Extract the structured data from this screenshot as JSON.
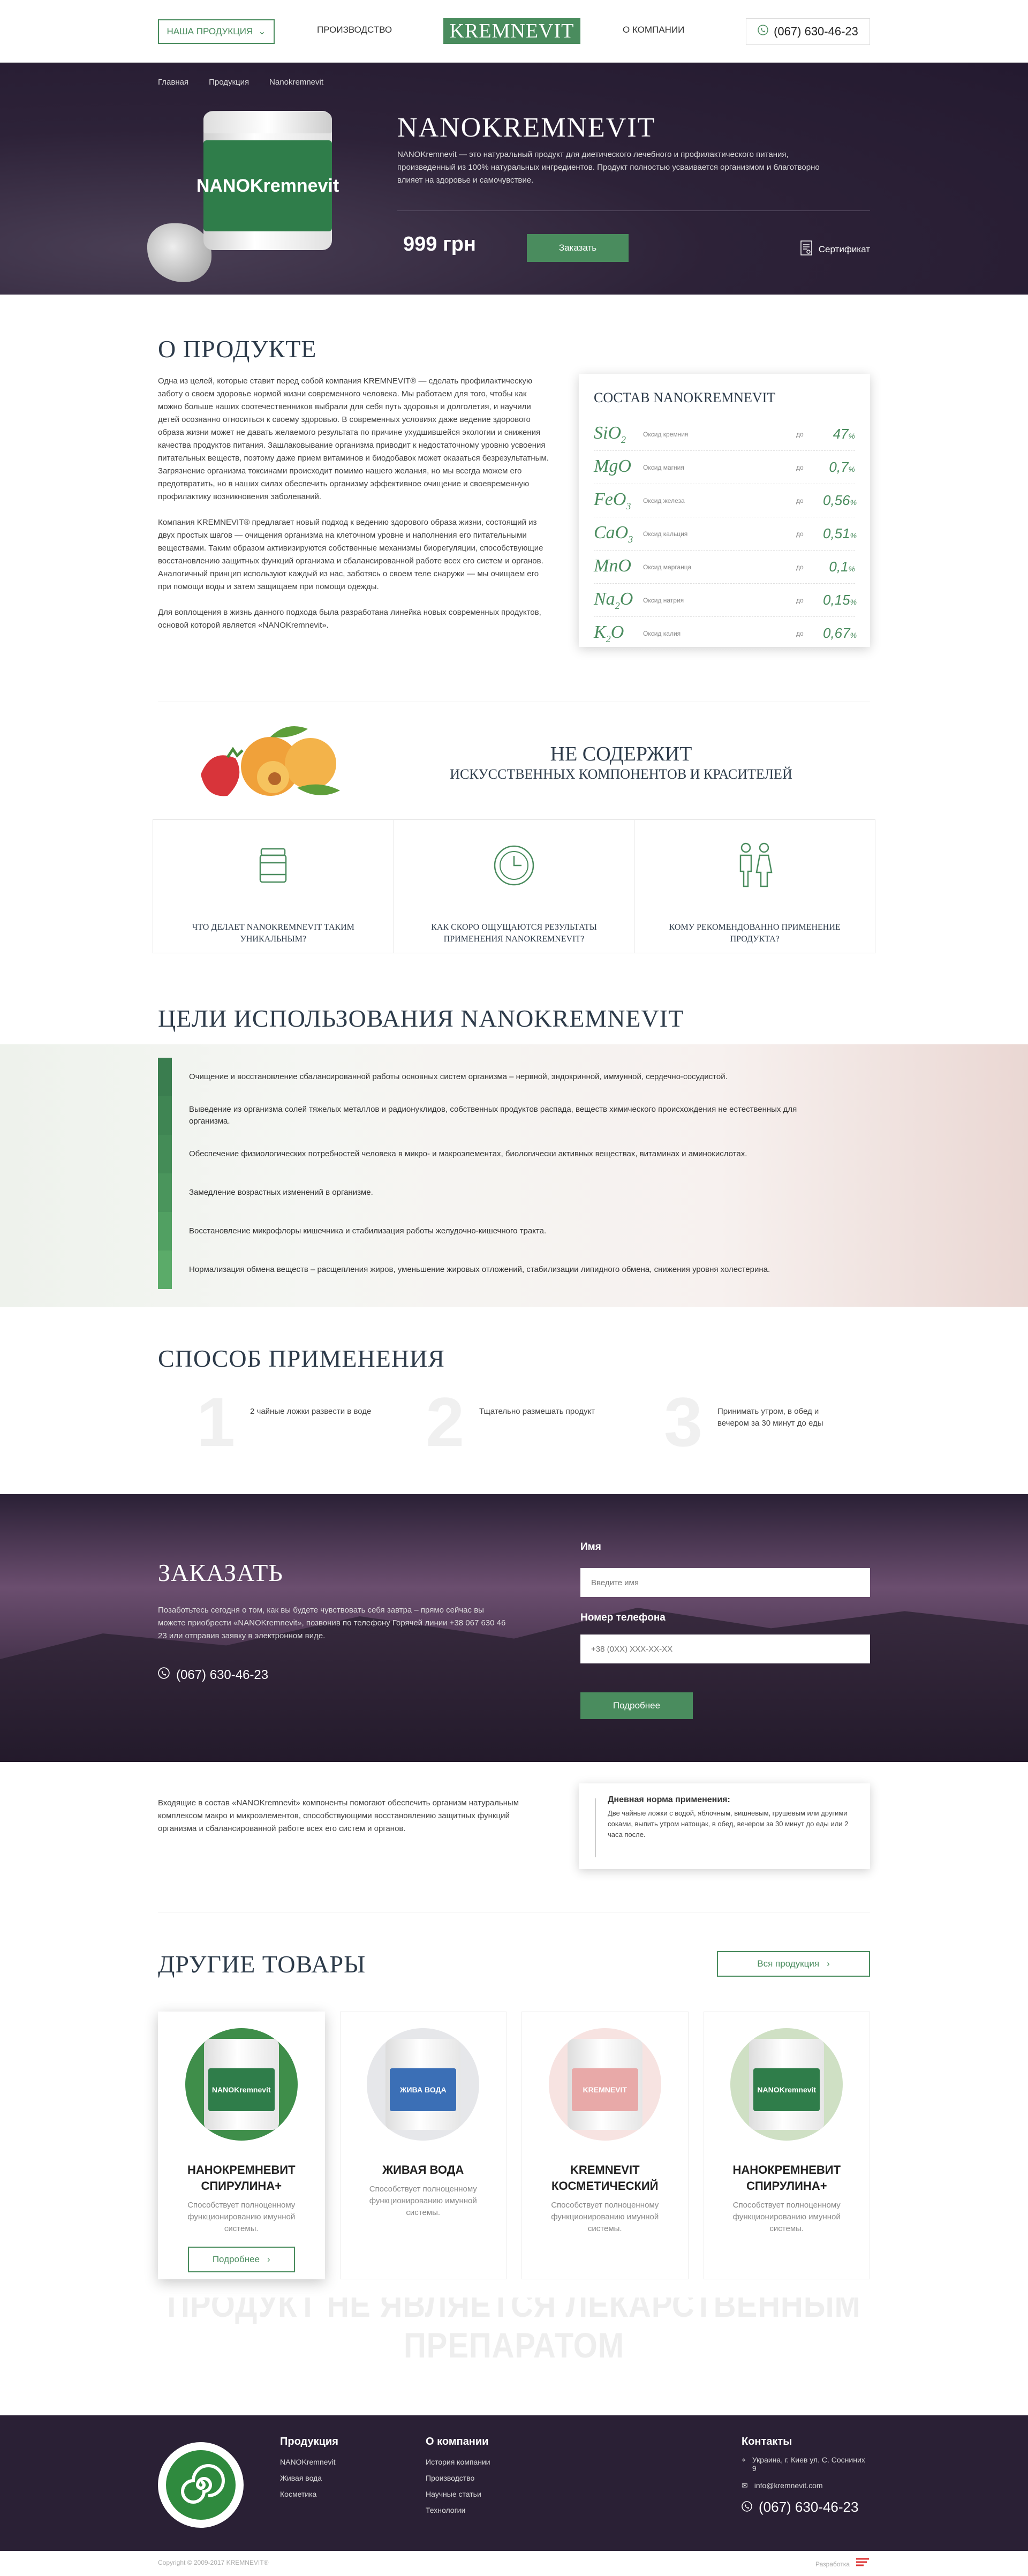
{
  "header": {
    "products_label": "НАША ПРОДУКЦИЯ",
    "nav": [
      "ПРОИЗВОДСТВО",
      "О КОМПАНИИ"
    ],
    "logo": "KREMNEVIT",
    "phone": "(067) 630-46-23"
  },
  "hero": {
    "breadcrumbs": [
      "Главная",
      "Продукция",
      "Nanokremnevit"
    ],
    "jar_label": "NANOKremnevit",
    "title": "NANOKREMNEVIT",
    "description": "NANOKremnevit — это натуральный продукт для диетического лечебного и профилактического питания, произведенный из 100% натуральных ингредиентов. Продукт полностью усваивается организмом и благотворно влияет на здоровье и самочувствие.",
    "price": "999 грн",
    "order_label": "Заказать",
    "certificate_label": "Сертификат"
  },
  "about": {
    "title": "О ПРОДУКТЕ",
    "paragraphs": [
      "Одна из целей, которые ставит перед собой компания KREMNEVIT® — сделать профилактическую заботу о своем здоровье нормой жизни современного человека. Мы работаем для того, чтобы как можно больше наших соотечественников выбрали для себя путь здоровья и долголетия, и научили детей осознанно относиться к своему здоровью. В современных условиях даже ведение здорового образа жизни может не давать желаемого результата по причине ухудшившейся экологии и снижения качества продуктов питания. Зашлаковывание организма приводит к недостаточному уровню усвоения питательных веществ, поэтому даже прием витаминов и биодобавок может оказаться безрезультатным. Загрязнение организма токсинами происходит помимо нашего желания, но мы всегда можем его предотвратить, но в наших силах обеспечить организму эффективное очищение и своевременную профилактику возникновения заболеваний.",
      "Компания KREMNEVIT® предлагает новый подход к ведению здорового образа жизни, состоящий из двух простых шагов — очищения организма на клеточном уровне и наполнения его питательными веществами. Таким образом активизируются собственные механизмы биорегуляции, способствующие восстановлению защитных функций организма и сбалансированной работе всех его систем и органов. Аналогичный принцип используют каждый из нас, заботясь о своем теле снаружи — мы очищаем его при помощи воды и затем защищаем при помощи одежды.",
      "Для воплощения в жизнь данного подхода была разработана линейка новых современных продуктов, основой которой является «NANOKremnevit»."
    ],
    "composition_title": "СОСТАВ NANOKREMNEVIT",
    "composition": [
      {
        "formula": "SiO",
        "sub": "2",
        "name": "Оксид кремния",
        "prefix": "до",
        "value": "47",
        "unit": "%"
      },
      {
        "formula": "MgO",
        "sub": "",
        "name": "Оксид магния",
        "prefix": "до",
        "value": "0,7",
        "unit": "%"
      },
      {
        "formula": "FeO",
        "sub": "3",
        "name": "Оксид железа",
        "prefix": "до",
        "value": "0,56",
        "unit": "%"
      },
      {
        "formula": "CaO",
        "sub": "3",
        "name": "Оксид кальция",
        "prefix": "до",
        "value": "0,51",
        "unit": "%"
      },
      {
        "formula": "MnO",
        "sub": "",
        "name": "Оксид марганца",
        "prefix": "до",
        "value": "0,1",
        "unit": "%"
      },
      {
        "formula": "Na",
        "sub": "2",
        "name": "Оксид натрия",
        "prefix": "до",
        "value": "0,15",
        "unit": "%",
        "tail": "O"
      },
      {
        "formula": "K",
        "sub": "2",
        "name": "Оксид калия",
        "prefix": "до",
        "value": "0,67",
        "unit": "%",
        "tail": "O"
      }
    ]
  },
  "noadd": {
    "line1": "НЕ СОДЕРЖИТ",
    "line2": "ИСКУССТВЕННЫХ КОМПОНЕНТОВ И КРАСИТЕЛЕЙ"
  },
  "faq": [
    {
      "icon": "jar-icon",
      "question": "ЧТО ДЕЛАЕТ NANOKREMNEVIT ТАКИМ УНИКАЛЬНЫМ?"
    },
    {
      "icon": "clock-icon",
      "question": "КАК СКОРО ОЩУЩАЮТСЯ РЕЗУЛЬТАТЫ ПРИМЕНЕНИЯ NANOKREMNEVIT?"
    },
    {
      "icon": "people-icon",
      "question": "КОМУ РЕКОМЕНДОВАННО ПРИМЕНЕНИЕ ПРОДУКТА?"
    }
  ],
  "goals": {
    "title": "ЦЕЛИ ИСПОЛЬЗОВАНИЯ NANOKREMNEVIT",
    "items": [
      "Очищение и восстановление сбалансированной работы основных систем организма – нервной, эндокринной, иммунной, сердечно-сосудистой.",
      "Выведение из организма солей тяжелых металлов и радионуклидов, собственных продуктов распада, веществ химического происхождения не естественных для организма.",
      "Обеспечение физиологических потребностей человека в микро- и макроэлементах, биологически активных веществах, витаминах и аминокислотах.",
      "Замедление возрастных изменений в организме.",
      "Восстановление микрофлоры кишечника и стабилизация работы желудочно-кишечного тракта.",
      "Нормализация обмена веществ – расщепления жиров, уменьшение жировых отложений, стабилизации липидного обмена, снижения уровня холестерина."
    ],
    "bar_colors": [
      "#3a7d4f",
      "#3f8553",
      "#448c57",
      "#4a955c",
      "#51a062",
      "#5bab69"
    ]
  },
  "method": {
    "title": "СПОСОБ ПРИМЕНЕНИЯ",
    "steps": [
      {
        "num": "1",
        "text": "2 чайные ложки развести в воде"
      },
      {
        "num": "2",
        "text": "Тщательно размешать продукт"
      },
      {
        "num": "3",
        "text": "Принимать утром, в обед и вечером за 30 минут до еды"
      }
    ]
  },
  "order": {
    "title": "ЗАКАЗАТЬ",
    "text": "Позаботьтесь сегодня о том, как вы будете чувствовать себя завтра – прямо сейчас вы можете приобрести «NANOKremnevit», позвонив по телефону Горячей линии +38 067 630 46 23 или отправив заявку в электронном виде.",
    "phone": "(067) 630-46-23",
    "name_label": "Имя",
    "name_placeholder": "Введите имя",
    "phone_label": "Номер телефона",
    "phone_placeholder": "+38 (0ХХ) ХХХ-ХХ-ХХ",
    "submit_label": "Подробнее"
  },
  "daily": {
    "text": "Входящие в состав «NANOKremnevit» компоненты помогают обеспечить организм натуральным комплексом макро и микроэлементов, способствующими восстановлению защитных функций организма и сбалансированной работе всех его систем и органов.",
    "box_title": "Дневная норма применения:",
    "box_text": "Две чайные ложки с водой, яблочным, вишневым, грушевым или другими соками, выпить утром натощак, в обед, вечером за 30 минут до еды или 2 часа после."
  },
  "others": {
    "title": "ДРУГИЕ ТОВАРЫ",
    "all_label": "Вся продукция",
    "products": [
      {
        "name": "НАНОКРЕМНЕВИТ СПИРУЛИНА+",
        "jar": "NANOKremnevit",
        "desc": "Способствует полноценному функционированию имунной системы.",
        "circle": "#3f8e4a",
        "label": "#2f7d4a",
        "more": "Подробнее"
      },
      {
        "name": "ЖИВАЯ ВОДА",
        "jar": "ЖИВА ВОДА",
        "desc": "Способствует полноценному функционированию имунной системы.",
        "circle": "#e6e7ea",
        "label": "#3b6fb6"
      },
      {
        "name": "KREMNEVIT КОСМЕТИЧЕСКИЙ",
        "jar": "KREMNEVIT",
        "desc": "Способствует полноценному функционированию имунной системы.",
        "circle": "#f7e3e1",
        "label": "#e8a9a8"
      },
      {
        "name": "НАНОКРЕМНЕВИТ СПИРУЛИНА+",
        "jar": "NANOKremnevit",
        "desc": "Способствует полноценному функционированию имунной системы.",
        "circle": "#cfe0c4",
        "label": "#2f7d4a"
      }
    ]
  },
  "disclaimer": "ПРОДУКТ НЕ ЯВЛЯЕТСЯ ЛЕКАРСТВЕННЫМ ПРЕПАРАТОМ",
  "footer": {
    "col1_title": "Продукция",
    "col1": [
      "NANOKremnevit",
      "Живая вода",
      "Косметика"
    ],
    "col2_title": "О компании",
    "col2": [
      "История компании",
      "Производство",
      "Научные статьи",
      "Технологии"
    ],
    "contacts_title": "Контакты",
    "address": "Украина, г. Киев ул. С. Сосниних 9",
    "email": "info@kremnevit.com",
    "phone": "(067) 630-46-23",
    "copyright": "Copyright © 2009-2017 KREMNEVIT®",
    "developer": "Разработка"
  }
}
